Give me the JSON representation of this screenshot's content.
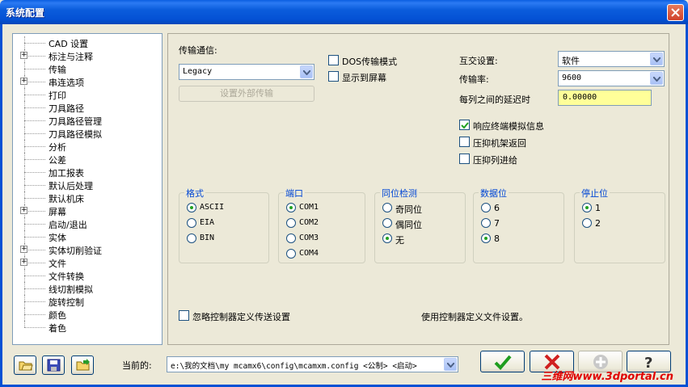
{
  "window": {
    "title": "系统配置"
  },
  "tree": {
    "items": [
      {
        "label": "CAD 设置",
        "expandable": false
      },
      {
        "label": "标注与注释",
        "expandable": true
      },
      {
        "label": "传输",
        "expandable": false
      },
      {
        "label": "串连选项",
        "expandable": true
      },
      {
        "label": "打印",
        "expandable": false
      },
      {
        "label": "刀具路径",
        "expandable": false
      },
      {
        "label": "刀具路径管理",
        "expandable": false
      },
      {
        "label": "刀具路径模拟",
        "expandable": false
      },
      {
        "label": "分析",
        "expandable": false
      },
      {
        "label": "公差",
        "expandable": false
      },
      {
        "label": "加工报表",
        "expandable": false
      },
      {
        "label": "默认后处理",
        "expandable": false
      },
      {
        "label": "默认机床",
        "expandable": false
      },
      {
        "label": "屏幕",
        "expandable": true
      },
      {
        "label": "启动/退出",
        "expandable": false
      },
      {
        "label": "实体",
        "expandable": false
      },
      {
        "label": "实体切削验证",
        "expandable": true
      },
      {
        "label": "文件",
        "expandable": true
      },
      {
        "label": "文件转换",
        "expandable": false
      },
      {
        "label": "线切割模拟",
        "expandable": false
      },
      {
        "label": "旋转控制",
        "expandable": false
      },
      {
        "label": "颜色",
        "expandable": false
      },
      {
        "label": "着色",
        "expandable": false
      }
    ]
  },
  "transfer": {
    "comm_label": "传输通信:",
    "comm_value": "Legacy",
    "setup_external_button": "设置外部传输",
    "dos_mode_label": "DOS传输模式",
    "show_on_screen_label": "显示到屏幕",
    "handshake_label": "互交设置:",
    "handshake_value": "软件",
    "baud_label": "传输率:",
    "baud_value": "9600",
    "delay_label": "每列之间的延迟时",
    "delay_value": "0.00000",
    "echo_label": "响应终端模拟信息",
    "suppress_cr_label": "压抑机架返回",
    "suppress_lf_label": "压抑列进给"
  },
  "groups": {
    "format": {
      "title": "格式",
      "options": [
        "ASCII",
        "EIA",
        "BIN"
      ],
      "selected": 0
    },
    "port": {
      "title": "端口",
      "options": [
        "COM1",
        "COM2",
        "COM3",
        "COM4"
      ],
      "selected": 0
    },
    "parity": {
      "title": "同位检测",
      "options": [
        "奇同位",
        "偶同位",
        "无"
      ],
      "selected": 2
    },
    "databits": {
      "title": "数据位",
      "options": [
        "6",
        "7",
        "8"
      ],
      "selected": 2
    },
    "stopbits": {
      "title": "停止位",
      "options": [
        "1",
        "2"
      ],
      "selected": 0
    }
  },
  "footer_options": {
    "ignore_control_label": "忽略控制器定义传送设置",
    "use_control_label": "使用控制器定义文件设置。"
  },
  "bottom": {
    "current_label": "当前的:",
    "current_value": "e:\\我的文档\\my mcamx6\\config\\mcamxm.config <公制> <启动>",
    "watermark": "三维网www.3dportal.cn"
  }
}
